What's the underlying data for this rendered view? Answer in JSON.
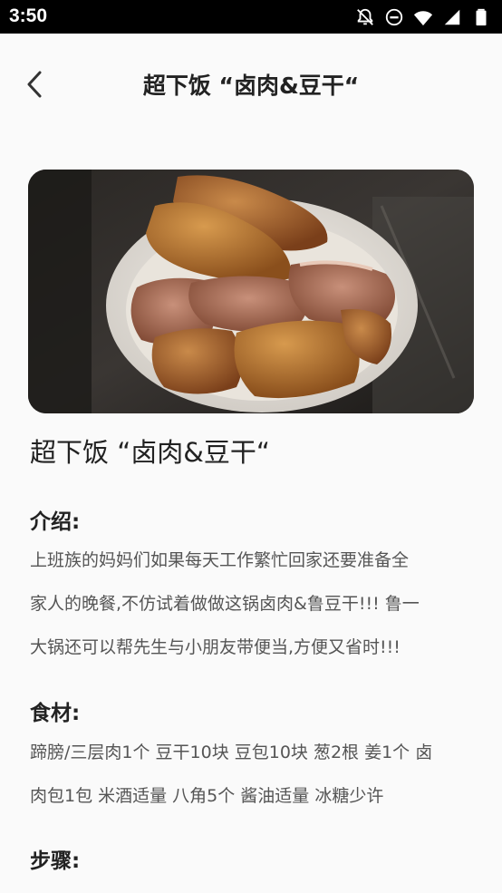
{
  "status_bar": {
    "time": "3:50",
    "icons": [
      "notifications-off-icon",
      "do-not-disturb-icon",
      "wifi-icon",
      "cellular-signal-icon",
      "battery-icon"
    ]
  },
  "app_bar": {
    "back_icon": "chevron-left-icon",
    "title": "超下饭 “卤肉&豆干“"
  },
  "recipe": {
    "image": "braised-pork-and-tofu-photo",
    "title": "超下饭 “卤肉&豆干“",
    "intro_heading": "介绍:",
    "intro_lines": [
      "上班族的妈妈们如果每天工作繁忙回家还要准备全",
      "家人的晚餐,不仿试着做做这锅卤肉&鲁豆干!!! 鲁一",
      "大锅还可以帮先生与小朋友带便当,方便又省时!!!"
    ],
    "ingredients_heading": "食材:",
    "ingredients_lines": [
      "蹄膀/三层肉1个 豆干10块 豆包10块 葱2根 姜1个 卤",
      "肉包1包 米酒适量 八角5个 酱油适量 冰糖少许"
    ],
    "steps_heading": "步骤:"
  }
}
